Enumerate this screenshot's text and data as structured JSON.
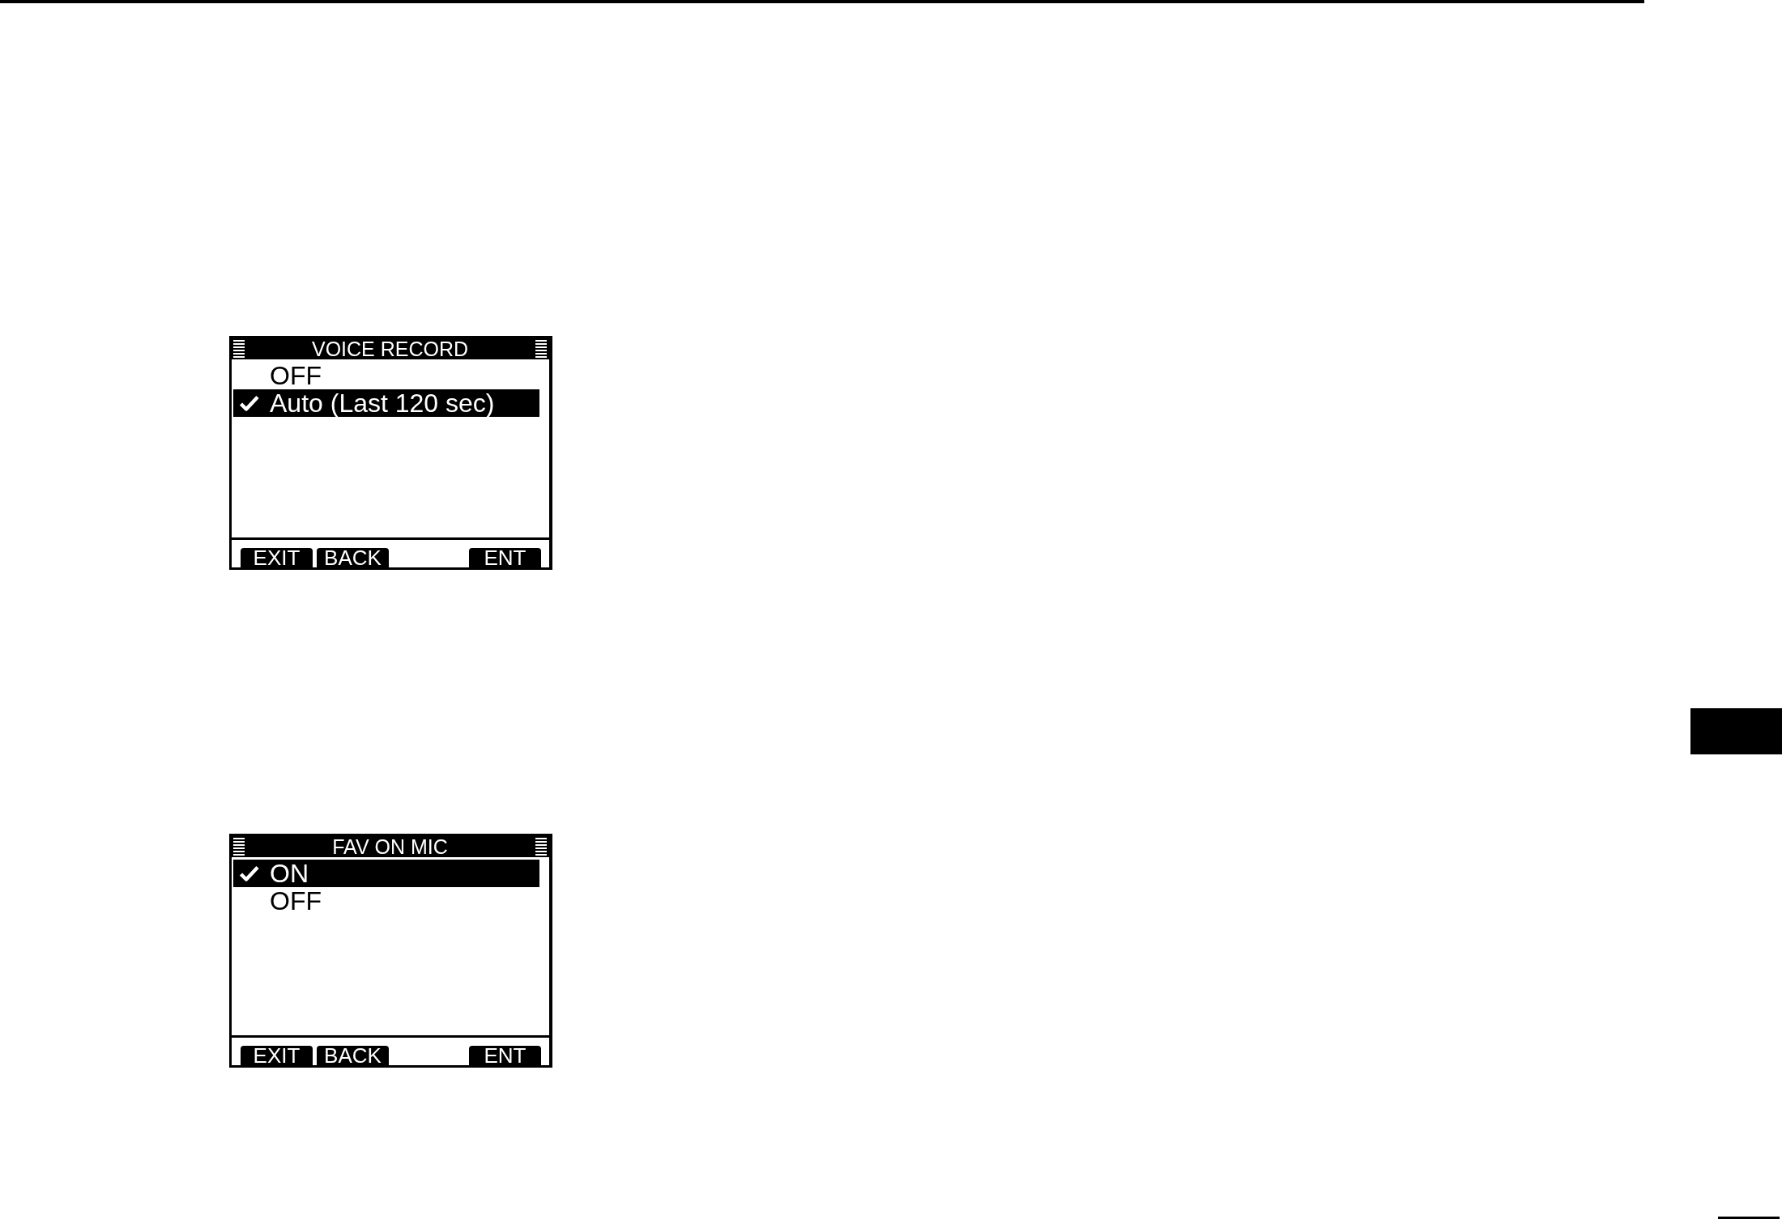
{
  "screens": [
    {
      "title": "VOICE RECORD",
      "options": [
        {
          "label": "OFF",
          "selected": false
        },
        {
          "label": "Auto (Last 120 sec)",
          "selected": true
        }
      ],
      "softkeys": [
        "EXIT",
        "BACK",
        "ENT"
      ]
    },
    {
      "title": "FAV ON MIC",
      "options": [
        {
          "label": "ON",
          "selected": true
        },
        {
          "label": "OFF",
          "selected": false
        }
      ],
      "softkeys": [
        "EXIT",
        "BACK",
        "ENT"
      ]
    }
  ]
}
